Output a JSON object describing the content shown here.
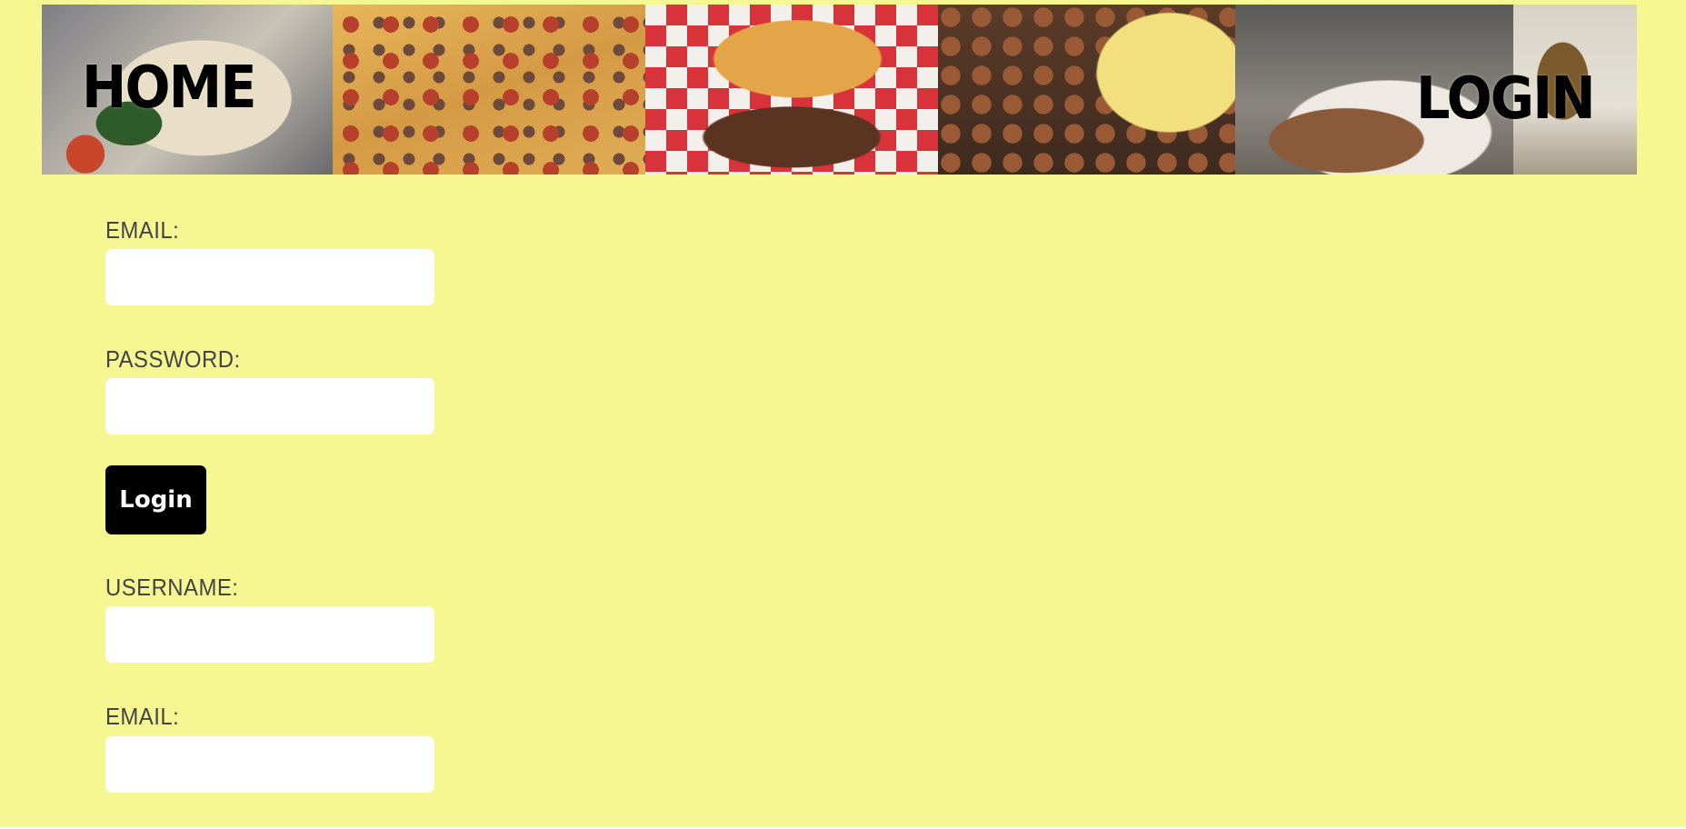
{
  "nav": {
    "home_label": "HOME",
    "login_label": "LOGIN"
  },
  "banner": {
    "images": [
      "pasta",
      "pizza",
      "sandwich",
      "breakfast-potatoes-eggs",
      "pulled-pork-fries",
      "plate-side"
    ]
  },
  "login_form": {
    "email_label": "EMAIL:",
    "email_value": "",
    "password_label": "PASSWORD:",
    "password_value": "",
    "submit_label": "Login"
  },
  "signup_form": {
    "username_label": "USERNAME:",
    "username_value": "",
    "email_label": "EMAIL:",
    "email_value": ""
  },
  "colors": {
    "page_background": "#f6f792",
    "button_background": "#000000",
    "button_text": "#ffffff",
    "label_text": "#444444"
  }
}
